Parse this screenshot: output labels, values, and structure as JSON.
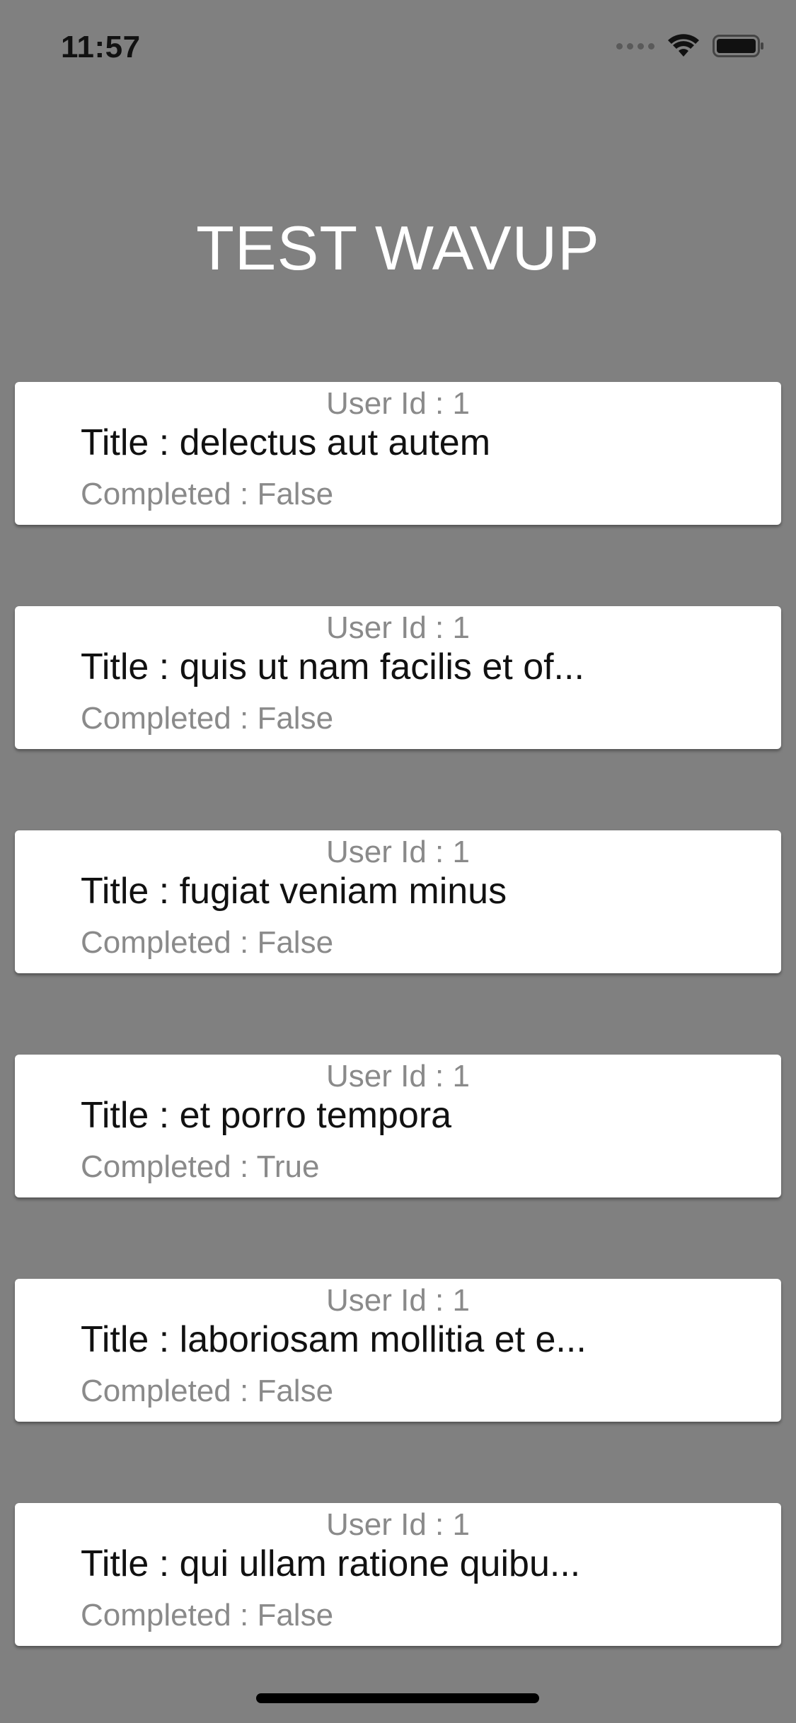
{
  "status_bar": {
    "time": "11:57",
    "icons": [
      "signal-dots-icon",
      "wifi-icon",
      "battery-icon"
    ]
  },
  "header": {
    "title": "TEST WAVUP"
  },
  "todos": [
    {
      "user": "User Id : 1",
      "title": "Title : delectus aut autem",
      "completed": "Completed : False"
    },
    {
      "user": "User Id : 1",
      "title": "Title : quis ut nam facilis et of...",
      "completed": "Completed : False"
    },
    {
      "user": "User Id : 1",
      "title": "Title : fugiat veniam minus",
      "completed": "Completed : False"
    },
    {
      "user": "User Id : 1",
      "title": "Title : et porro tempora",
      "completed": "Completed : True"
    },
    {
      "user": "User Id : 1",
      "title": "Title : laboriosam mollitia et e...",
      "completed": "Completed : False"
    },
    {
      "user": "User Id : 1",
      "title": "Title : qui ullam ratione quibu...",
      "completed": "Completed : False"
    }
  ],
  "colors": {
    "background": "#808080",
    "card": "#ffffff",
    "title_text": "#111111",
    "secondary_text": "#8a8a8a",
    "header_text": "#ffffff"
  }
}
